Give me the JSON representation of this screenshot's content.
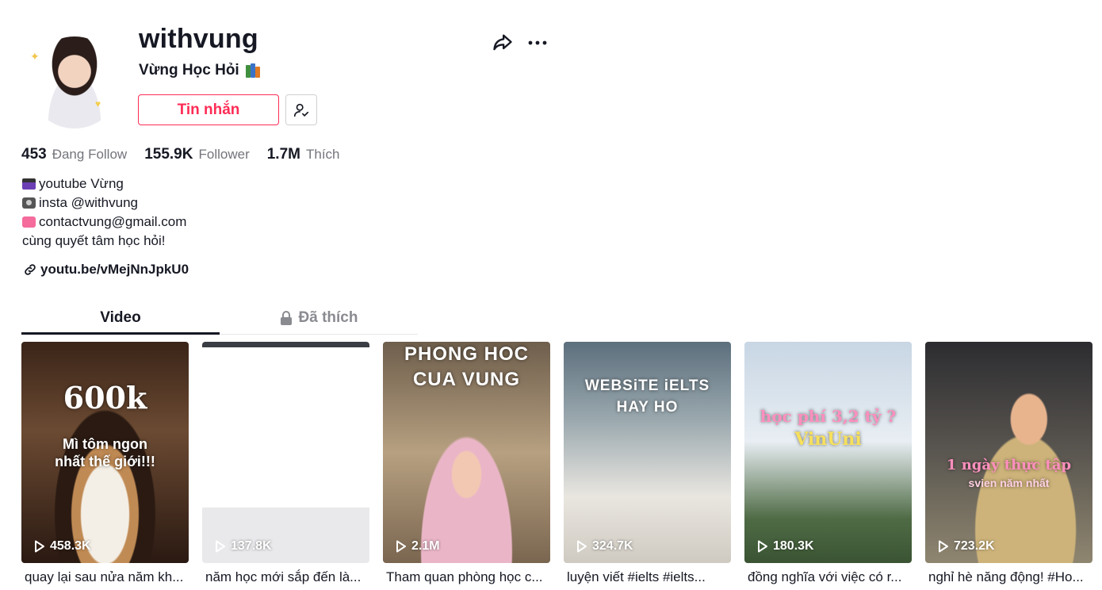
{
  "profile": {
    "username": "withvung",
    "nickname": "Vừng Học Hỏi",
    "message_button": "Tin nhắn"
  },
  "stats": [
    {
      "value": "453",
      "label": "Đang Follow"
    },
    {
      "value": "155.9K",
      "label": "Follower"
    },
    {
      "value": "1.7M",
      "label": "Thích"
    }
  ],
  "bio": {
    "line1": "youtube Vừng",
    "line2": "insta @withvung",
    "line3": "contactvung@gmail.com",
    "line4": "cùng quyết tâm học hỏi!"
  },
  "link": "youtu.be/vMejNnJpkU0",
  "tabs": {
    "video": "Video",
    "liked": "Đã thích"
  },
  "videos": [
    {
      "views": "458.3K",
      "caption": "quay lại sau nửa năm kh...",
      "overlay_top": "600k",
      "overlay_bottom": "Mì tôm ngon\nnhất thế giới!!!"
    },
    {
      "views": "137.8K",
      "caption": "năm học mới sắp đến là...",
      "overlay_top": "",
      "overlay_bottom": ""
    },
    {
      "views": "2.1M",
      "caption": "Tham quan phòng học c...",
      "overlay_top": "PHONG HOC\nCUA VUNG",
      "overlay_bottom": ""
    },
    {
      "views": "324.7K",
      "caption": "luyện viết #ielts #ielts...",
      "overlay_top": "WEBSiTE iELTS\nHAY HO",
      "overlay_bottom": ""
    },
    {
      "views": "180.3K",
      "caption": "đồng nghĩa với việc có r...",
      "overlay_top": "học phí 3,2 tỷ ?",
      "overlay_bottom": "VinUni"
    },
    {
      "views": "723.2K",
      "caption": "nghỉ hè năng động! #Ho...",
      "overlay_top": "1 ngày thực tập",
      "overlay_bottom": "svien năm nhất"
    }
  ],
  "colors": {
    "accent": "#fe2c55",
    "text": "#161823",
    "muted": "#73757c"
  }
}
